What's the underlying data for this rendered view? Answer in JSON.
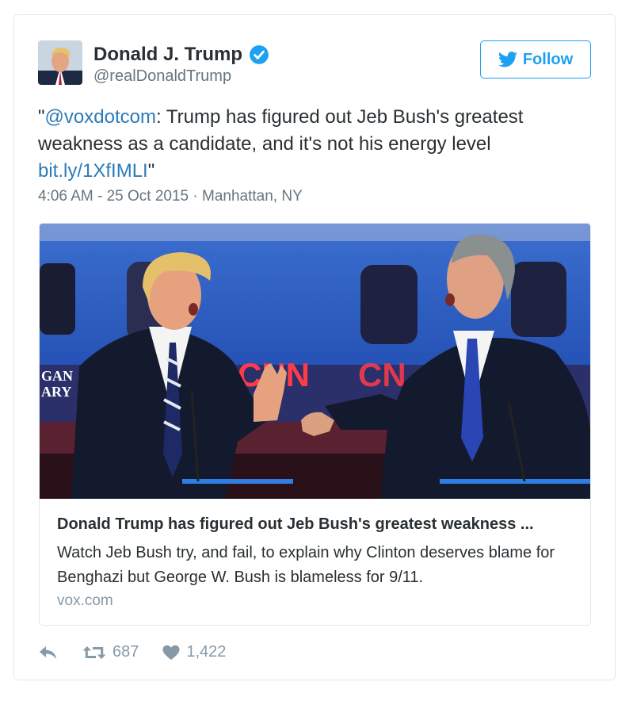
{
  "author": {
    "name": "Donald J. Trump",
    "handle": "@realDonaldTrump",
    "verified_icon": "verified-badge-icon",
    "avatar_icon": "avatar"
  },
  "follow_button": {
    "label": "Follow",
    "icon": "twitter-bird-icon"
  },
  "tweet": {
    "quote_open": "\"",
    "mention": "@voxdotcom",
    "body": ": Trump has figured out Jeb Bush's greatest weakness as a candidate, and it's not his energy level ",
    "link": "bit.ly/1XfIMLI",
    "quote_close": "\""
  },
  "meta": {
    "time": "4:06 AM - 25 Oct 2015",
    "separator": " · ",
    "location": "Manhattan, NY"
  },
  "card": {
    "image_sign_text": "CNN",
    "image_left_sign_1": "GAN",
    "image_left_sign_2": "ARY",
    "title": "Donald Trump has figured out Jeb Bush's greatest weakness ...",
    "description": "Watch Jeb Bush try, and fail, to explain why Clinton deserves blame for Benghazi but George W. Bush is blameless for 9/11.",
    "domain": "vox.com"
  },
  "actions": {
    "reply_icon": "reply-icon",
    "retweet_icon": "retweet-icon",
    "retweet_count": "687",
    "like_icon": "heart-icon",
    "like_count": "1,422"
  },
  "colors": {
    "link": "#2b7bb9",
    "accent": "#1da1f2",
    "muted": "#66757f",
    "border": "#e1e8ed"
  }
}
